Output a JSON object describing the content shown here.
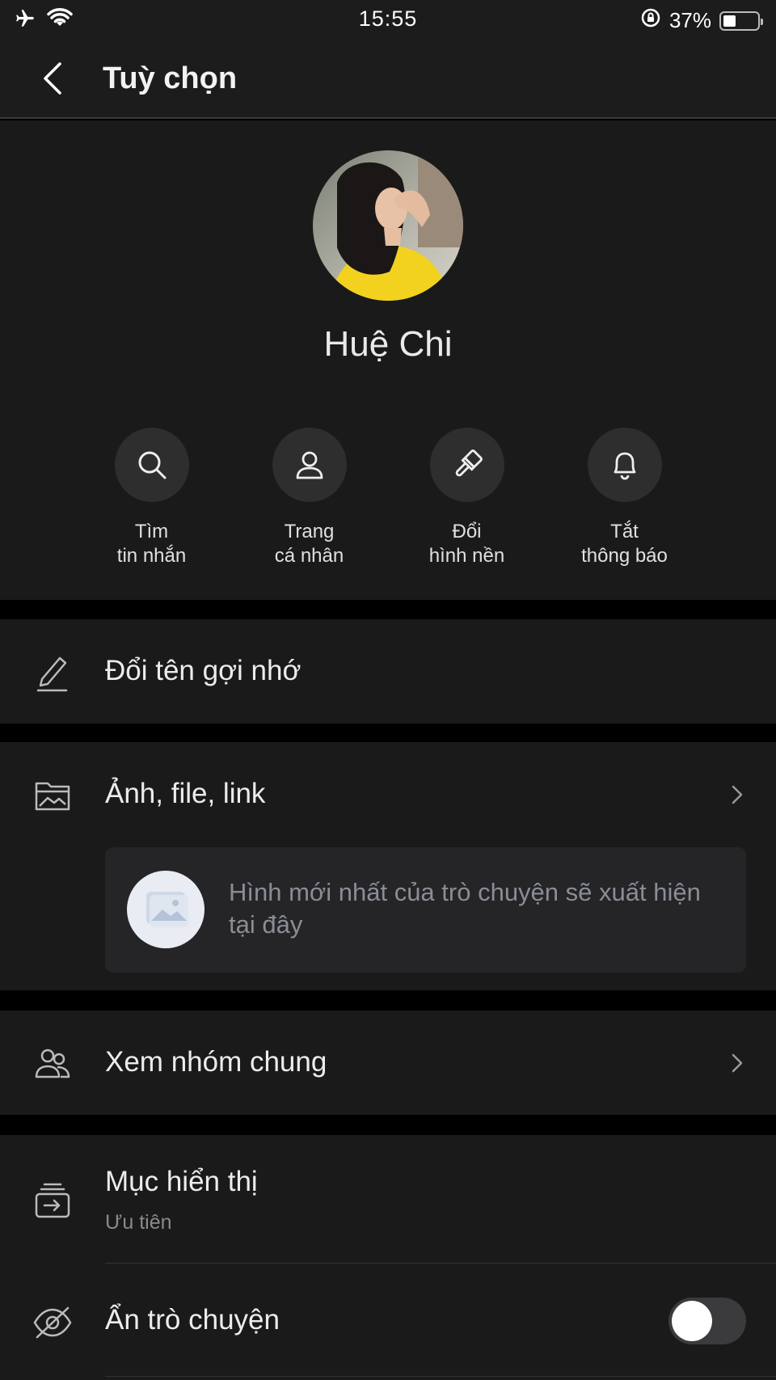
{
  "status_bar": {
    "time": "15:55",
    "battery_percent": "37%",
    "battery_level": 0.37
  },
  "nav": {
    "title": "Tuỳ chọn"
  },
  "profile": {
    "name": "Huệ Chi"
  },
  "actions": [
    {
      "icon": "search-icon",
      "label": "Tìm\ntin nhắn"
    },
    {
      "icon": "person-icon",
      "label": "Trang\ncá nhân"
    },
    {
      "icon": "paint-brush-icon",
      "label": "Đổi\nhình nền"
    },
    {
      "icon": "bell-icon",
      "label": "Tắt\nthông báo"
    }
  ],
  "rename": {
    "label": "Đổi tên gợi nhớ"
  },
  "media": {
    "label": "Ảnh, file, link",
    "empty_text": "Hình mới nhất của trò chuyện sẽ xuất hiện tại đây"
  },
  "groups": {
    "label": "Xem nhóm chung"
  },
  "display": {
    "label": "Mục hiển thị",
    "value": "Ưu tiên"
  },
  "hide_chat": {
    "label": "Ẩn trò chuyện",
    "enabled": false
  }
}
